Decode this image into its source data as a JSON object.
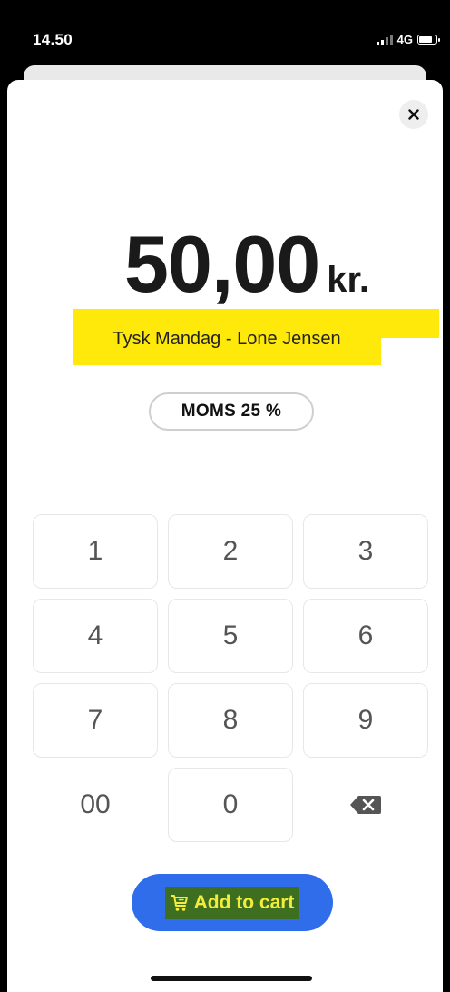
{
  "status_bar": {
    "time": "14.50",
    "network": "4G"
  },
  "sheet": {
    "close_icon": "close-icon"
  },
  "amount": {
    "value": "50,00",
    "currency": "kr."
  },
  "product": {
    "name": "Tysk Mandag - Lone Jensen",
    "highlight_color": "#ffe90a"
  },
  "vat": {
    "label": "MOMS 25 %"
  },
  "keypad": {
    "keys": [
      "1",
      "2",
      "3",
      "4",
      "5",
      "6",
      "7",
      "8",
      "9",
      "00",
      "0"
    ],
    "backspace_icon": "backspace-icon"
  },
  "cart": {
    "label": "Add to cart",
    "icon": "cart-icon",
    "accent_color": "#2f6dea"
  }
}
